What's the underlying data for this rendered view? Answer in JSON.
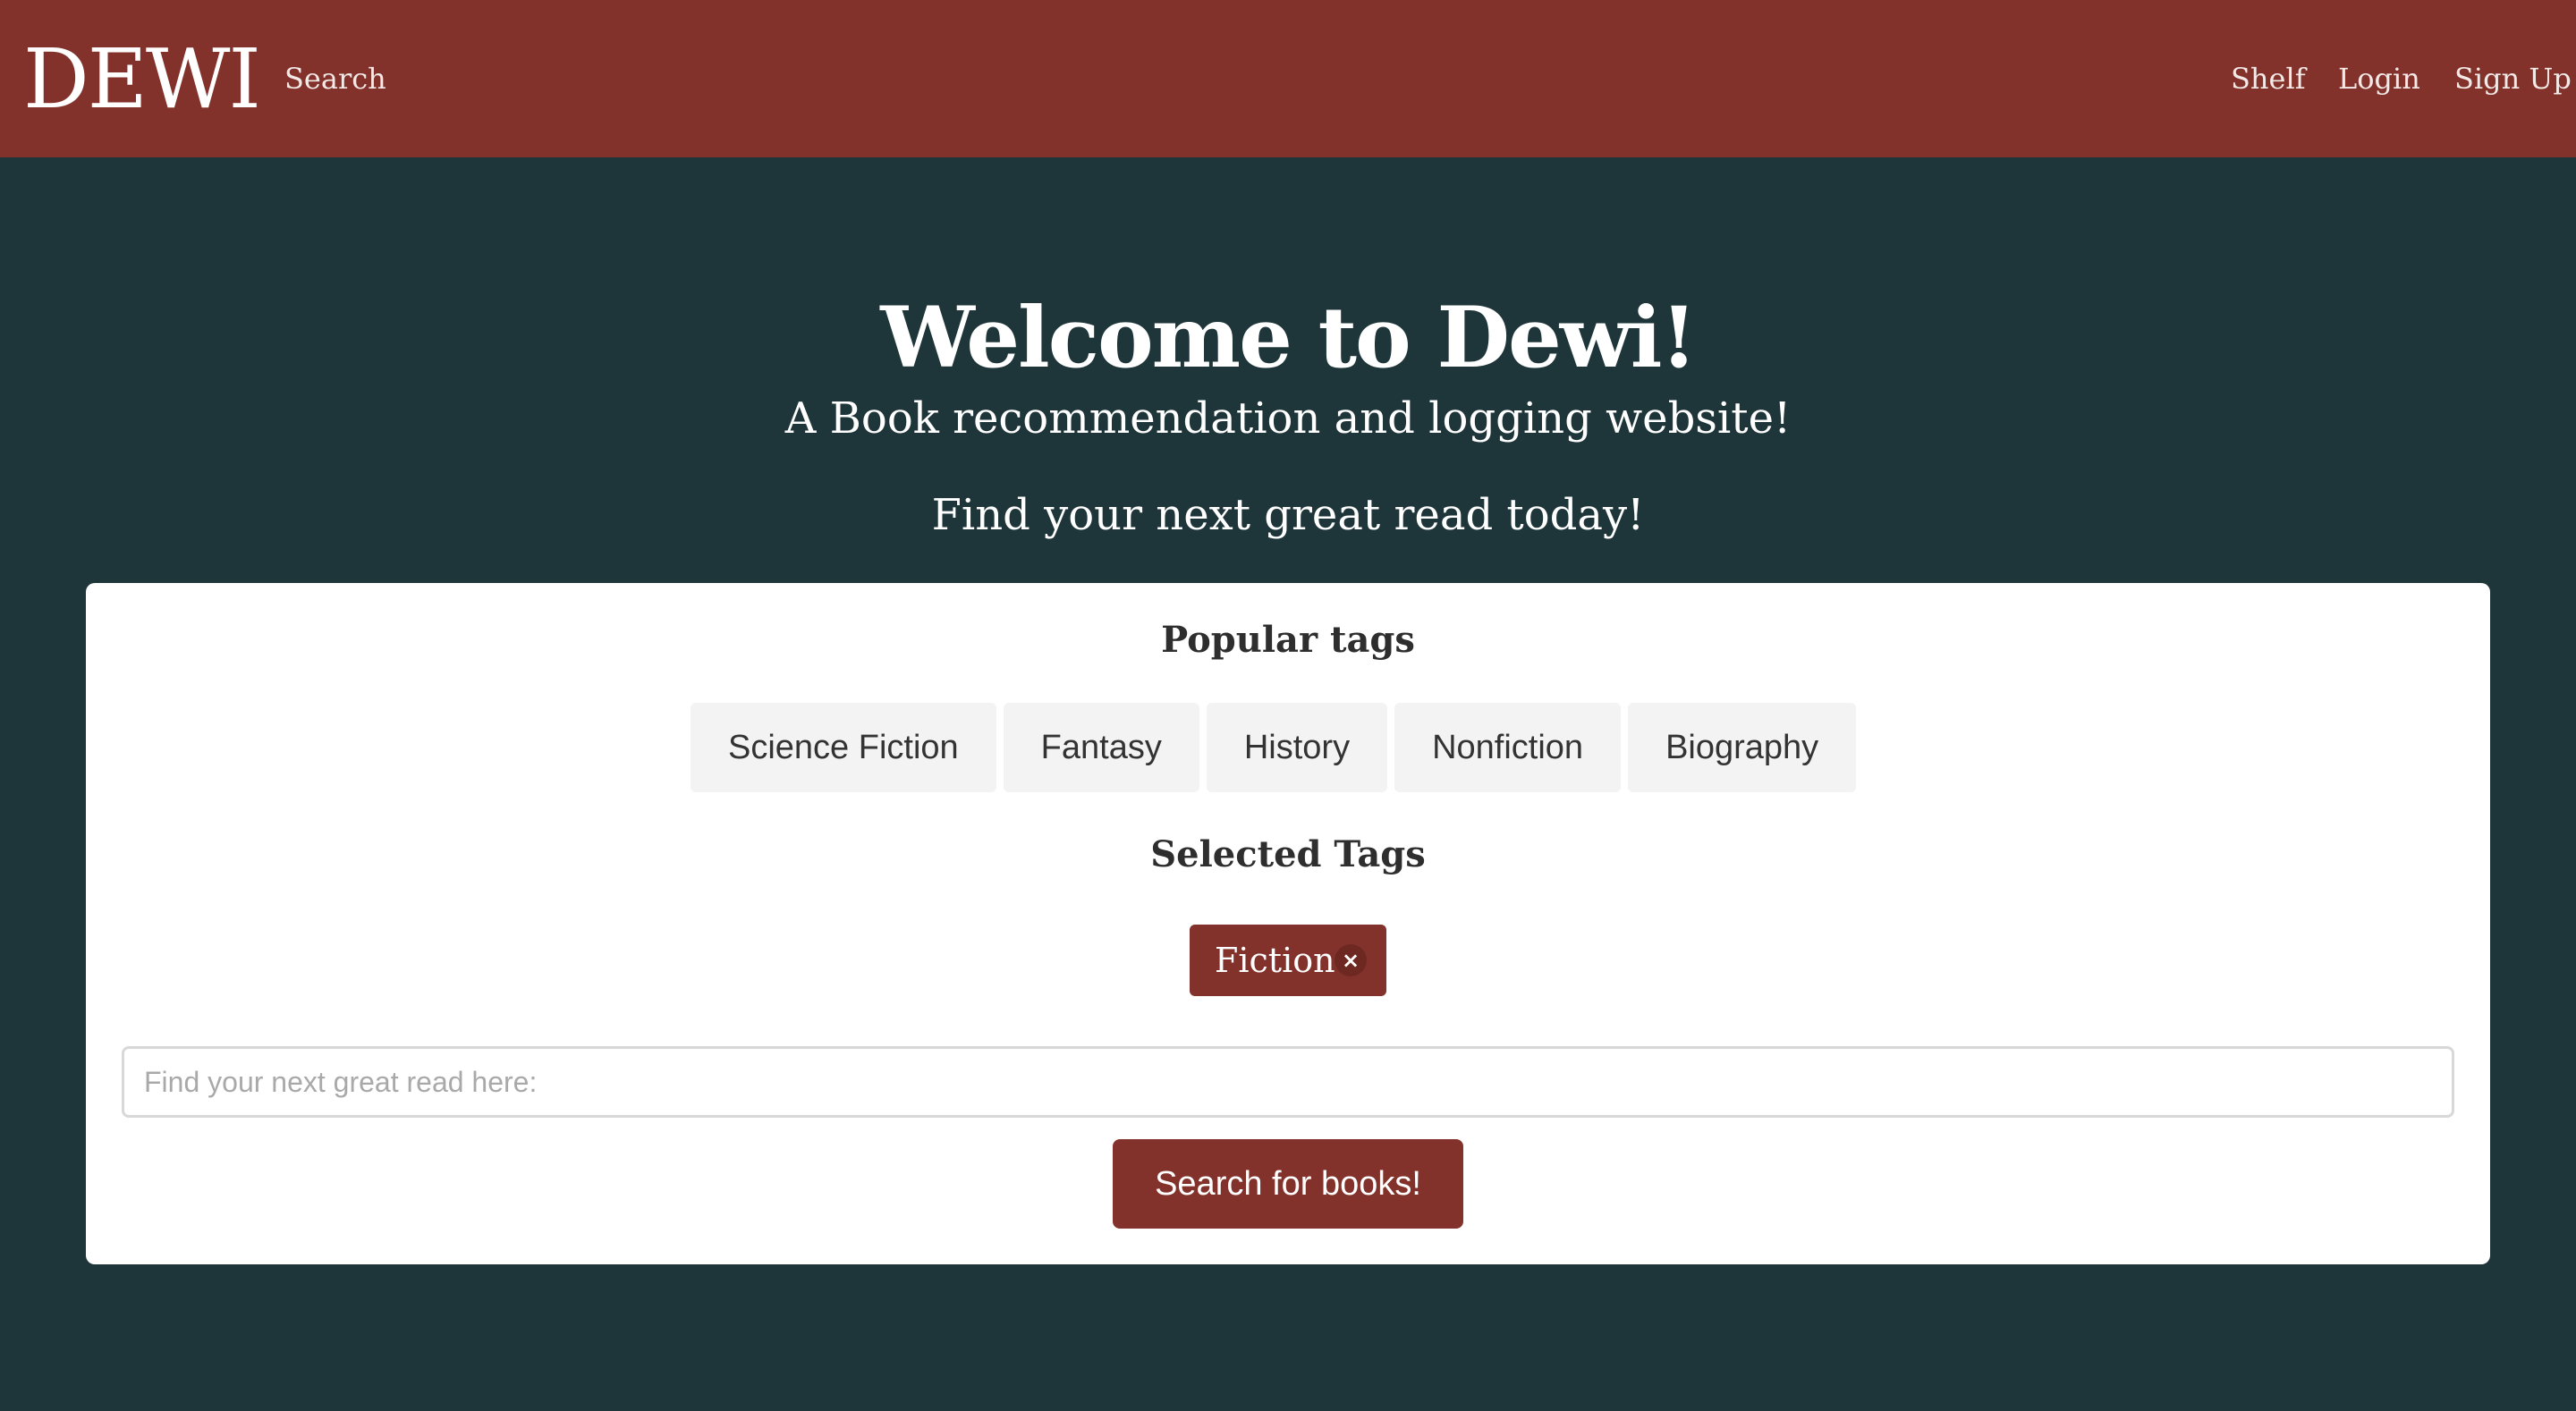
{
  "navbar": {
    "brand": "DEWI",
    "search_link": "Search",
    "shelf_link": "Shelf",
    "login_link": "Login",
    "signup_link": "Sign Up"
  },
  "hero": {
    "title": "Welcome to Dewi!",
    "subtitle": "A Book recommendation and logging website!",
    "cta": "Find your next great read today!"
  },
  "card": {
    "popular_heading": "Popular tags",
    "popular_tags": [
      "Science Fiction",
      "Fantasy",
      "History",
      "Nonfiction",
      "Biography"
    ],
    "selected_heading": "Selected Tags",
    "selected_tags": [
      {
        "label": "Fiction",
        "remove_icon": "×"
      }
    ],
    "search": {
      "placeholder": "Find your next great read here:",
      "value": ""
    },
    "search_button": "Search for books!"
  },
  "colors": {
    "brand_red": "#83322b",
    "background_teal": "#1e3539",
    "tag_gray": "#f3f3f3",
    "card_white": "#ffffff"
  }
}
